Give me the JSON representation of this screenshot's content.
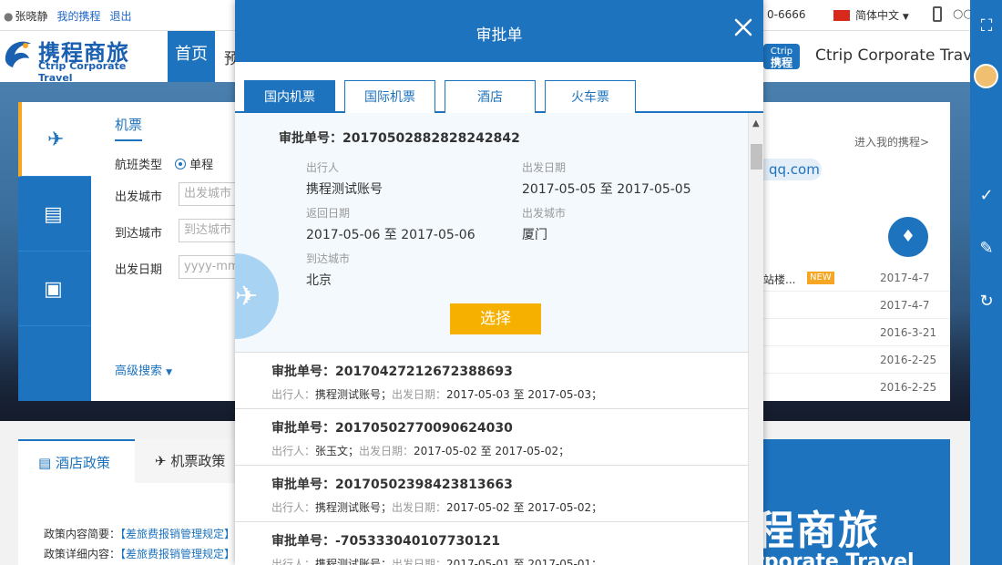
{
  "topbar": {
    "user_name": "张晓静",
    "my_trips": "我的携程",
    "logout": "退出",
    "phone": "0-6666",
    "language": "简体中文"
  },
  "header": {
    "logo_cn": "携程商旅",
    "logo_en": "Ctrip Corporate Travel",
    "nav_home": "首页",
    "nav_partial": "预",
    "mini_logo_en": "Ctrip",
    "mini_logo_cn": "携程",
    "brand_text": "Ctrip Corporate Travel"
  },
  "search": {
    "title": "机票",
    "flight_type_label": "航班类型",
    "flight_type_value": "单程",
    "from_label": "出发城市",
    "from_placeholder": "出发城市",
    "to_label": "到达城市",
    "to_placeholder": "到达城市",
    "date_label": "出发日期",
    "date_placeholder": "yyyy-mm",
    "advanced": "高级搜索"
  },
  "right_panel": {
    "enter_link": "进入我的携程>",
    "email_partial": "qq.com",
    "news": [
      {
        "title": "站楼...",
        "badge": "NEW",
        "date": "2017-4-7"
      },
      {
        "title": "",
        "badge": "",
        "date": "2017-4-7"
      },
      {
        "title": "",
        "badge": "",
        "date": "2016-3-21"
      },
      {
        "title": "",
        "badge": "",
        "date": "2016-2-25"
      },
      {
        "title": "",
        "badge": "",
        "date": "2016-2-25"
      }
    ]
  },
  "policy": {
    "tab_hotel": "酒店政策",
    "tab_flight": "机票政策",
    "summary_label": "政策内容简要：",
    "summary_value": "【差旅费报销管理规定】",
    "detail_label": "政策详细内容：",
    "detail_value": "【差旅费报销管理规定】"
  },
  "banner": {
    "cn": "程商旅",
    "en": "rporate Travel"
  },
  "modal": {
    "title": "审批单",
    "tabs": [
      {
        "label": "国内机票",
        "active": true
      },
      {
        "label": "国际机票",
        "active": false
      },
      {
        "label": "酒店",
        "active": false
      },
      {
        "label": "火车票",
        "active": false
      }
    ],
    "selected": {
      "number": "审批单号：20170502882828242842",
      "traveler_label": "出行人",
      "traveler": "携程测试账号",
      "depart_date_label": "出发日期",
      "depart_date": "2017-05-05 至 2017-05-05",
      "return_date_label": "返回日期",
      "return_date": "2017-05-06 至 2017-05-06",
      "depart_city_label": "出发城市",
      "depart_city": "厦门",
      "arrive_city_label": "到达城市",
      "arrive_city": "北京",
      "select_button": "选择"
    },
    "items": [
      {
        "number": "审批单号：20170427212672388693",
        "k1": "出行人：",
        "traveler": "携程测试账号；",
        "k2": "出发日期：",
        "date": "2017-05-03 至 2017-05-03；"
      },
      {
        "number": "审批单号：20170502770090624030",
        "k1": "出行人：",
        "traveler": "张玉文；",
        "k2": "出发日期：",
        "date": "2017-05-02 至 2017-05-02；"
      },
      {
        "number": "审批单号：20170502398423813663",
        "k1": "出行人：",
        "traveler": "携程测试账号；",
        "k2": "出发日期：",
        "date": "2017-05-02 至 2017-05-02；"
      },
      {
        "number": "审批单号：-705333040107730121",
        "k1": "出行人：",
        "traveler": "携程测试账号；",
        "k2": "出发日期：",
        "date": "2017-05-01 至 2017-05-01；"
      }
    ]
  },
  "colors": {
    "brand_blue": "#1e73be",
    "select_orange": "#f6b100",
    "new_badge": "#f6a623"
  }
}
